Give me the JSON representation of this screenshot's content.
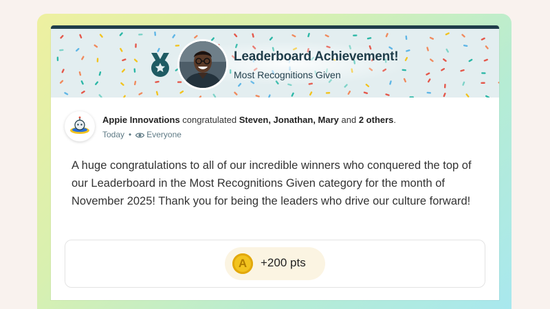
{
  "banner": {
    "title": "Leaderboard Achievement!",
    "subtitle": "Most Recognitions Given"
  },
  "post": {
    "author": "Appie Innovations",
    "verb": " congratulated ",
    "recipients": "Steven, Jonathan, Mary",
    "and_text": " and ",
    "others": "2 others",
    "period": ".",
    "time": "Today",
    "separator": "•",
    "visibility": "Everyone",
    "message": "A huge congratulations to all of our incredible winners who conquered the top of our Leaderboard in the Most Recognitions Given category for the month of November 2025! Thank you for being the leaders who drive our culture forward!"
  },
  "points": {
    "label": "+200 pts"
  },
  "colors": {
    "accent": "#1f3d4a",
    "banner_bg": "#e3eef0",
    "coin": "#f2c31f",
    "meta_text": "#5e7a85"
  },
  "icons": {
    "badge": "medal-icon",
    "visibility": "eye-icon",
    "coin": "coin-icon"
  }
}
